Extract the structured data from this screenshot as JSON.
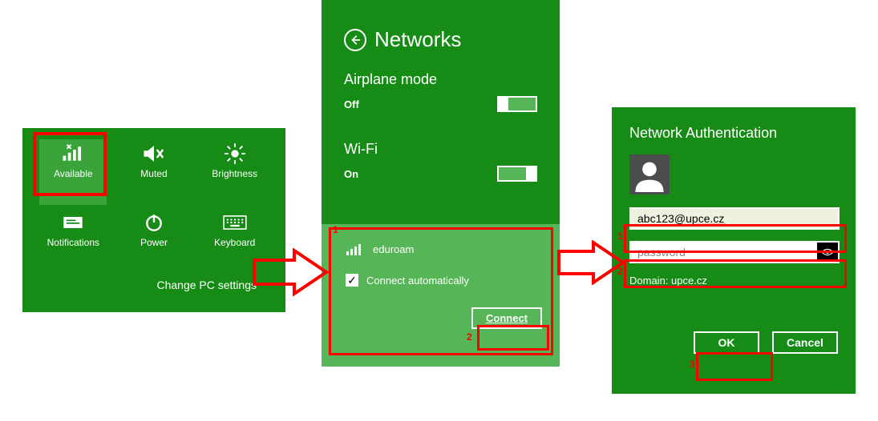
{
  "charms": {
    "items": [
      {
        "label": "Available"
      },
      {
        "label": "Muted"
      },
      {
        "label": "Brightness"
      },
      {
        "label": "Notifications"
      },
      {
        "label": "Power"
      },
      {
        "label": "Keyboard"
      }
    ],
    "footer": "Change PC settings"
  },
  "networks": {
    "title": "Networks",
    "airplane_label": "Airplane mode",
    "airplane_state": "Off",
    "wifi_label": "Wi-Fi",
    "wifi_state": "On",
    "ssid": "eduroam",
    "auto_connect_label": "Connect automatically",
    "connect_label": "Connect"
  },
  "auth": {
    "title": "Network Authentication",
    "username": "abc123@upce.cz",
    "password_placeholder": "password",
    "domain_label": "Domain: upce.cz",
    "ok_label": "OK",
    "cancel_label": "Cancel"
  },
  "annotations": {
    "n1": "1",
    "n2": "2",
    "a1": "1",
    "a2": "2",
    "a3": "3"
  }
}
